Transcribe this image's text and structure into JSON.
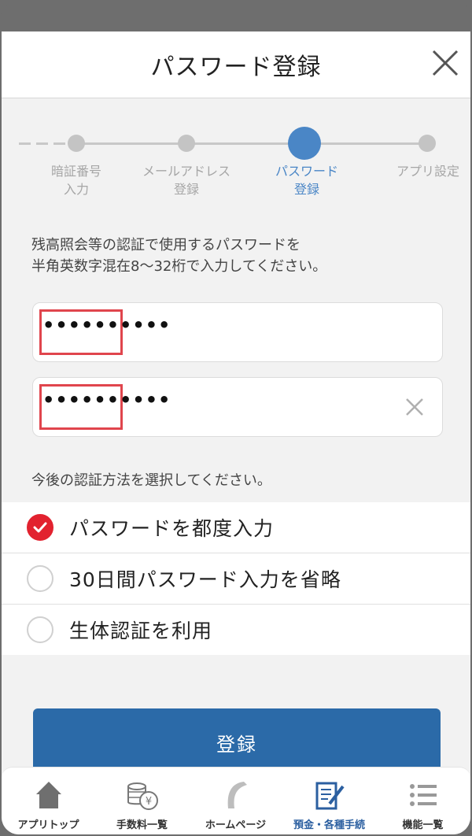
{
  "header": {
    "title": "パスワード登録"
  },
  "stepper": {
    "steps": [
      {
        "label": "暗証番号\n入力"
      },
      {
        "label": "メールアドレス\n登録"
      },
      {
        "label": "パスワード\n登録"
      },
      {
        "label": "アプリ設定"
      }
    ],
    "active_index": 2
  },
  "instruction": "残高照会等の認証で使用するパスワードを\n半角英数字混在8～32桁で入力してください。",
  "password": {
    "value": "••••••••••"
  },
  "password_confirm": {
    "value": "••••••••••"
  },
  "auth_prompt": "今後の認証方法を選択してください。",
  "auth_options": [
    {
      "label": "パスワードを都度入力",
      "checked": true
    },
    {
      "label": "30日間パスワード入力を省略",
      "checked": false
    },
    {
      "label": "生体認証を利用",
      "checked": false
    }
  ],
  "register_button": "登録",
  "tabbar": {
    "tabs": [
      {
        "label": "アプリトップ",
        "icon": "home-icon"
      },
      {
        "label": "手数料一覧",
        "icon": "yen-coins-icon"
      },
      {
        "label": "ホームページ",
        "icon": "bank-logo-icon"
      },
      {
        "label": "預金・各種手続",
        "icon": "document-pen-icon"
      },
      {
        "label": "機能一覧",
        "icon": "list-icon"
      }
    ],
    "active_index": 3
  },
  "colors": {
    "accent": "#2b6aa8",
    "step_active": "#4a86c6",
    "check": "#e2222f",
    "highlight_box": "#e0454d"
  }
}
